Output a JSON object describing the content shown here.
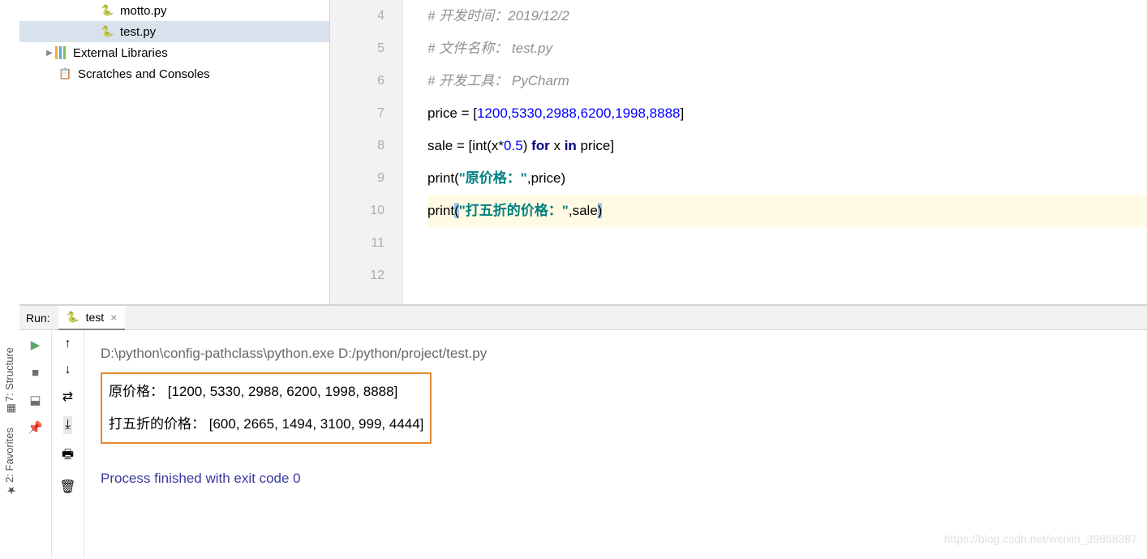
{
  "tree": {
    "motto": "motto.py",
    "test": "test.py",
    "ext_lib": "External Libraries",
    "scratches": "Scratches and Consoles"
  },
  "gutter": [
    "4",
    "5",
    "6",
    "7",
    "8",
    "9",
    "10",
    "11",
    "12"
  ],
  "code": {
    "l4": "# 开发时间：2019/12/2",
    "l5_a": "# 文件名称： ",
    "l5_b": "test.py",
    "l6_a": "# 开发工具： ",
    "l6_b": "PyCharm",
    "l7_a": "price = [",
    "l7_nums": "1200,5330,2988,6200,1998,8888",
    "l7_b": "]",
    "l8_a": "sale = [",
    "l8_b": "int",
    "l8_c": "(x*",
    "l8_d": "0.5",
    "l8_e": ") ",
    "l8_f": "for",
    "l8_g": " x ",
    "l8_h": "in",
    "l8_i": " price]",
    "l9_a": "print",
    "l9_b": "(",
    "l9_c": "\"原价格：\"",
    "l9_d": ",price)",
    "l10_a": "print",
    "l10_b": "(",
    "l10_c": "\"打五折的价格：\"",
    "l10_d": ",sale",
    "l10_e": ")"
  },
  "run": {
    "label": "Run:",
    "tab": "test",
    "cmd": "D:\\python\\config-pathclass\\python.exe D:/python/project/test.py",
    "out1": "原价格： [1200, 5330, 2988, 6200, 1998, 8888]",
    "out2": "打五折的价格： [600, 2665, 1494, 3100, 999, 4444]",
    "exit": "Process finished with exit code 0"
  },
  "left_tabs": {
    "structure": "7: Structure",
    "favorites": "2: Favorites"
  },
  "watermark": "https://blog.csdn.net/weixin_39868387"
}
